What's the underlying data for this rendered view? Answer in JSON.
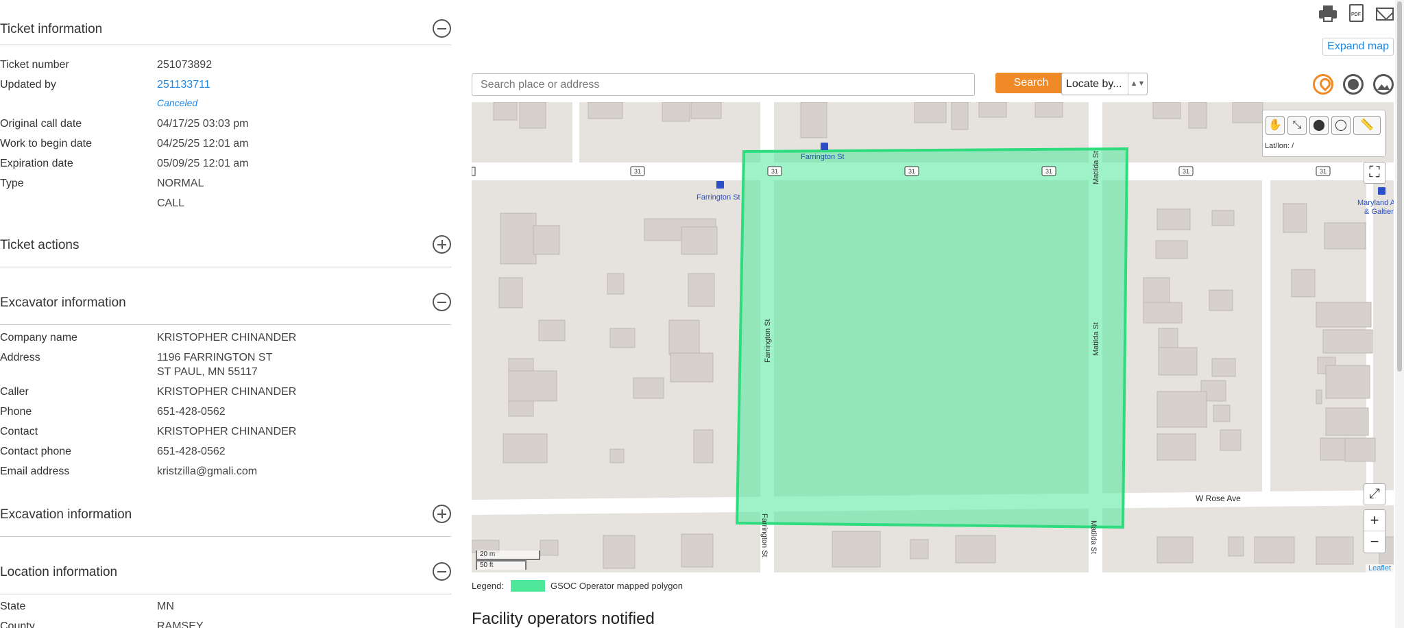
{
  "ticket_info": {
    "title": "Ticket information",
    "rows": [
      {
        "label": "Ticket number",
        "value": "251073892"
      },
      {
        "label": "Updated by",
        "value": "251133711"
      },
      {
        "label": "Original call date",
        "value": "04/17/25 03:03 pm"
      },
      {
        "label": "Work to begin date",
        "value": "04/25/25 12:01 am"
      },
      {
        "label": "Expiration date",
        "value": "05/09/25 12:01 am"
      },
      {
        "label": "Type",
        "value": "NORMAL"
      }
    ],
    "updated_status": "Canceled",
    "type_extra": "CALL"
  },
  "ticket_actions": {
    "title": "Ticket actions"
  },
  "excavator": {
    "title": "Excavator information",
    "company_label": "Company name",
    "company": "KRISTOPHER CHINANDER",
    "address_label": "Address",
    "address1": "1196 FARRINGTON ST",
    "address2": "ST PAUL, MN 55117",
    "caller_label": "Caller",
    "caller": "KRISTOPHER CHINANDER",
    "phone_label": "Phone",
    "phone": "651-428-0562",
    "contact_label": "Contact",
    "contact": "KRISTOPHER CHINANDER",
    "contact_phone_label": "Contact phone",
    "contact_phone": "651-428-0562",
    "email_label": "Email address",
    "email": "kristzilla@gmali.com"
  },
  "excavation": {
    "title": "Excavation information"
  },
  "location": {
    "title": "Location information",
    "state_label": "State",
    "state": "MN",
    "county_label": "County",
    "county": "RAMSEY"
  },
  "toolbar": {
    "print_icon": "printer-icon",
    "pdf_icon": "pdf-icon",
    "pdf_text": "PDF",
    "mail_icon": "mail-icon",
    "expand_map": "Expand map"
  },
  "search": {
    "placeholder": "Search place or address",
    "button": "Search",
    "locate_by": "Locate by..."
  },
  "map": {
    "tools_latlon": "Lat/lon:  /",
    "street_labels": {
      "farrington_top": "Farrington St",
      "farrington_left": "Farrington St",
      "farrington_vertical": "Farrington St",
      "farrington_bottom": "Farrington St",
      "matilda_top": "Matilda St",
      "matilda_mid": "Matilda St",
      "matilda_bottom": "Matilda St",
      "rose": "W Rose Ave",
      "maryland1": "Maryland A",
      "maryland2": "& Galtier"
    },
    "route_shield": "31",
    "scale_m": "20 m",
    "scale_ft": "50 ft",
    "attribution": "Leaflet",
    "zoom_in": "+",
    "zoom_out": "−",
    "polygon_color": "#4fe89a"
  },
  "legend": {
    "label": "Legend:",
    "item": "GSOC Operator mapped polygon"
  },
  "facility": {
    "title": "Facility operators notified"
  }
}
